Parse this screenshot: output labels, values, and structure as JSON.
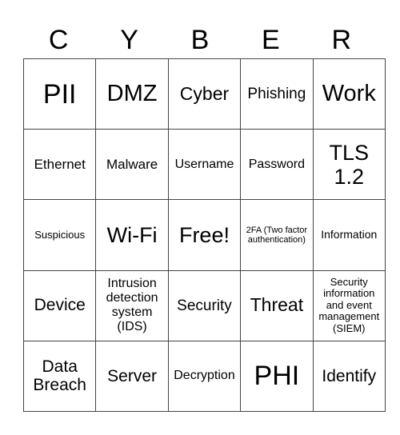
{
  "header": [
    "C",
    "Y",
    "B",
    "E",
    "R"
  ],
  "board": [
    [
      "PII",
      "DMZ",
      "Cyber",
      "Phishing",
      "Work"
    ],
    [
      "Ethernet",
      "Malware",
      "Username",
      "Password",
      "TLS 1.2"
    ],
    [
      "Suspicious",
      "Wi-Fi",
      "Free!",
      "2FA (Two factor authentication)",
      "Information"
    ],
    [
      "Device",
      "Intrusion detection system (IDS)",
      "Security",
      "Threat",
      "Security information and event management (SIEM)"
    ],
    [
      "Data Breach",
      "Server",
      "Decryption",
      "PHI",
      "Identify"
    ]
  ]
}
